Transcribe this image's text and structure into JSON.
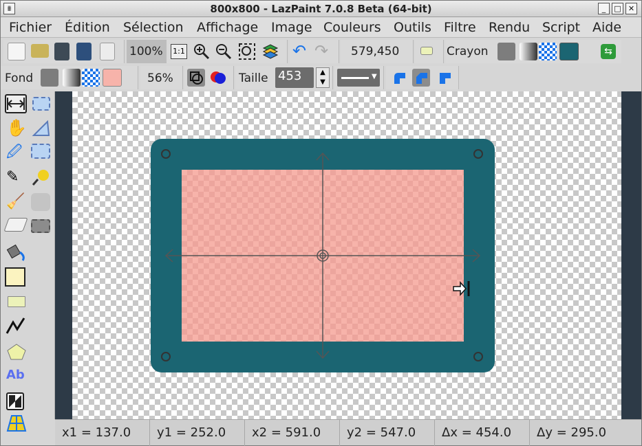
{
  "window": {
    "title": "800x800 - LazPaint 7.0.8 Beta (64-bit)"
  },
  "menu": [
    "Fichier",
    "Édition",
    "Sélection",
    "Affichage",
    "Image",
    "Couleurs",
    "Outils",
    "Filtre",
    "Rendu",
    "Script",
    "Aide"
  ],
  "toolbar1": {
    "zoom": "100%",
    "zoom_actual": "1:1",
    "coords": "579,450",
    "tool_name": "Crayon"
  },
  "toolbar2": {
    "fill_label": "Fond",
    "opacity": "56%",
    "size_label": "Taille",
    "size_value": "453"
  },
  "status": {
    "x1": "x1 = 137.0",
    "y1": "y1 = 252.0",
    "x2": "x2 = 591.0",
    "y2": "y2 = 547.0",
    "dx": "Δx = 454.0",
    "dy": "Δy = 295.0"
  },
  "colors": {
    "pen": "#1b6572",
    "fill": "#f7b3aa",
    "accent": "#1a73e8"
  },
  "icons": {
    "text_tool": "Ab"
  }
}
